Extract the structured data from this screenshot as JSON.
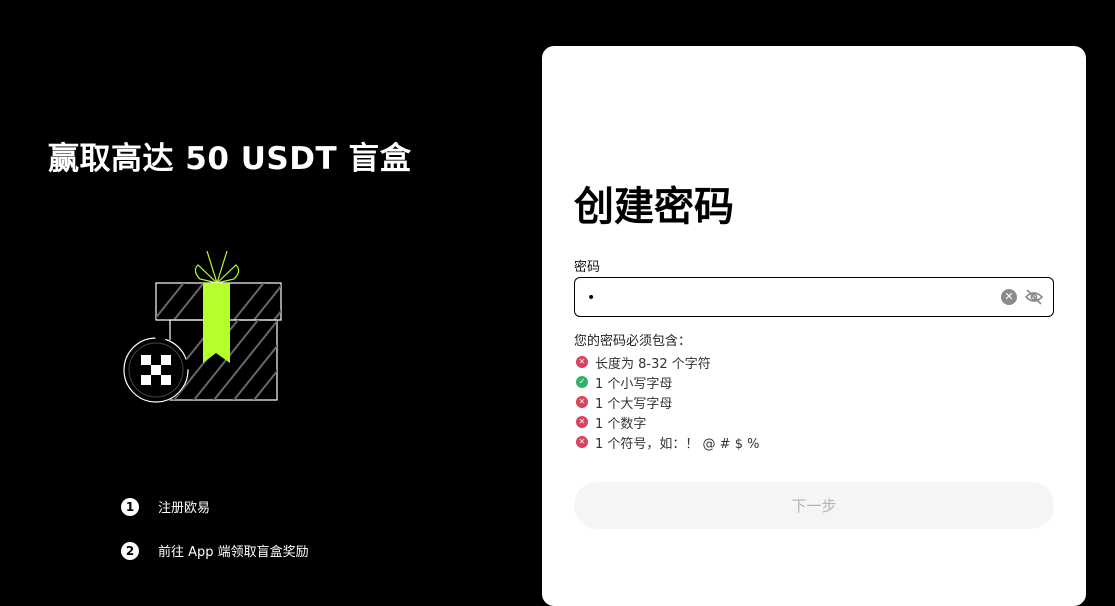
{
  "promo": {
    "title": "赢取高达 50 USDT 盲盒",
    "steps": [
      {
        "num": "1",
        "text": "注册欧易"
      },
      {
        "num": "2",
        "text": "前往 App 端领取盲盒奖励"
      }
    ]
  },
  "form": {
    "title": "创建密码",
    "password_label": "密码",
    "password_value": "•",
    "requirements_title": "您的密码必须包含：",
    "requirements": [
      {
        "text": "长度为 8-32 个字符",
        "met": false
      },
      {
        "text": "1 个小写字母",
        "met": true
      },
      {
        "text": "1 个大写字母",
        "met": false
      },
      {
        "text": "1 个数字",
        "met": false
      },
      {
        "text": "1 个符号，如：！ @ # $ %",
        "met": false
      }
    ],
    "next_label": "下一步"
  },
  "colors": {
    "accent": "#b5ff2b",
    "error": "#d9425c",
    "success": "#2db36a"
  }
}
